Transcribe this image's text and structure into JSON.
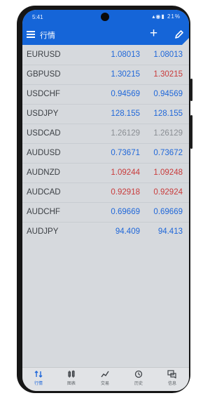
{
  "status_bar": {
    "time": "5:41",
    "battery": "21%"
  },
  "toolbar": {
    "title": "行情"
  },
  "quotes": [
    {
      "symbol": "EURUSD",
      "bid": "1.08013",
      "ask": "1.08013",
      "bid_color": "#1f67d9",
      "ask_color": "#1f67d9"
    },
    {
      "symbol": "GBPUSD",
      "bid": "1.30215",
      "ask": "1.30215",
      "bid_color": "#1f67d9",
      "ask_color": "#c93b3b"
    },
    {
      "symbol": "USDCHF",
      "bid": "0.94569",
      "ask": "0.94569",
      "bid_color": "#1f67d9",
      "ask_color": "#1f67d9"
    },
    {
      "symbol": "USDJPY",
      "bid": "128.155",
      "ask": "128.155",
      "bid_color": "#1f67d9",
      "ask_color": "#1f67d9"
    },
    {
      "symbol": "USDCAD",
      "bid": "1.26129",
      "ask": "1.26129",
      "bid_color": "#8a8e93",
      "ask_color": "#8a8e93"
    },
    {
      "symbol": "AUDUSD",
      "bid": "0.73671",
      "ask": "0.73672",
      "bid_color": "#1f67d9",
      "ask_color": "#1f67d9"
    },
    {
      "symbol": "AUDNZD",
      "bid": "1.09244",
      "ask": "1.09248",
      "bid_color": "#c93b3b",
      "ask_color": "#c93b3b"
    },
    {
      "symbol": "AUDCAD",
      "bid": "0.92918",
      "ask": "0.92924",
      "bid_color": "#c93b3b",
      "ask_color": "#c93b3b"
    },
    {
      "symbol": "AUDCHF",
      "bid": "0.69669",
      "ask": "0.69669",
      "bid_color": "#1f67d9",
      "ask_color": "#1f67d9"
    },
    {
      "symbol": "AUDJPY",
      "bid": "94.409",
      "ask": "94.413",
      "bid_color": "#1f67d9",
      "ask_color": "#1f67d9"
    }
  ],
  "nav": {
    "items": [
      {
        "label": "行情",
        "icon": "quotes-icon",
        "active": true
      },
      {
        "label": "图表",
        "icon": "chart-icon",
        "active": false
      },
      {
        "label": "交易",
        "icon": "trade-icon",
        "active": false
      },
      {
        "label": "历史",
        "icon": "history-icon",
        "active": false
      },
      {
        "label": "信息",
        "icon": "messages-icon",
        "active": false
      }
    ]
  },
  "colors": {
    "accent": "#1565d8",
    "up": "#1f67d9",
    "down": "#c93b3b",
    "unchanged": "#8a8e93"
  }
}
